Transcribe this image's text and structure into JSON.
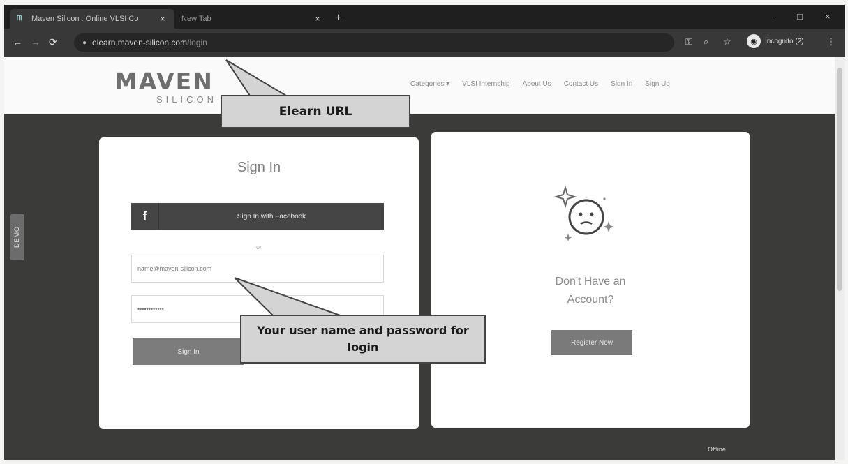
{
  "browser": {
    "tabs": [
      {
        "title": "Maven Silicon : Online VLSI Co",
        "active": true
      },
      {
        "title": "New Tab",
        "active": false
      }
    ],
    "new_tab": "+",
    "close_glyph": "×",
    "window_controls": [
      "–",
      "□",
      "×"
    ],
    "url_host": "elearn.maven-silicon.com",
    "url_path": "/login",
    "incognito_label": "Incognito (2)",
    "icons": [
      "back-icon",
      "forward-icon",
      "reload-icon",
      "lock-icon",
      "key-icon",
      "zoom-icon",
      "star-icon",
      "incognito-icon",
      "menu-icon"
    ]
  },
  "site": {
    "logo_main": "MAVEN",
    "logo_sub": "SILICON",
    "nav": [
      "Categories ▾",
      "VLSI Internship",
      "About Us",
      "Contact Us",
      "Sign In",
      "Sign Up"
    ]
  },
  "feedback_tab": "DEMO",
  "signin": {
    "title": "Sign In",
    "facebook_icon": "f",
    "facebook_label": "Sign In with Facebook",
    "or_text": "or",
    "email_value": "name@maven-silicon.com",
    "password_value": "••••••••••••",
    "button_label": "Sign In"
  },
  "register": {
    "line1": "Don't Have an",
    "line2": "Account?",
    "button_label": "Register Now"
  },
  "status": {
    "offline": "Offline"
  },
  "annotations": {
    "url_callout": "Elearn URL",
    "login_callout_line1": "Your user name and password for",
    "login_callout_line2": "login"
  },
  "colors": {
    "chrome_dark": "#1f1f1f",
    "page_background": "#3b3b39",
    "callout_fill": "#d4d4d4",
    "button_gray": "#7c7c7c"
  }
}
